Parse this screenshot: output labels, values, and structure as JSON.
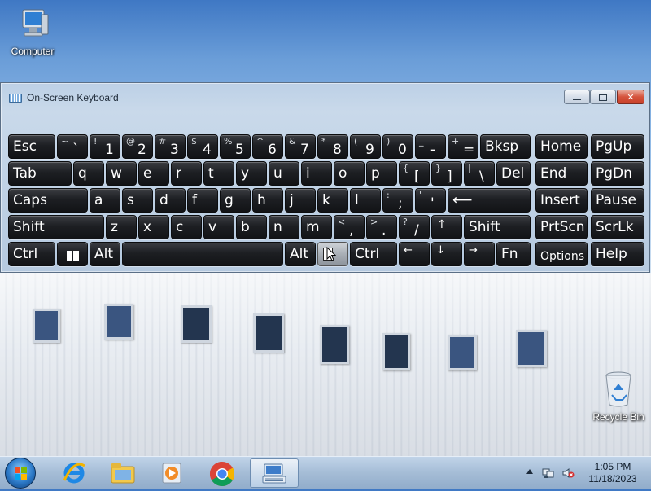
{
  "desktop": {
    "icons": [
      {
        "label": "Computer",
        "icon": "computer-icon"
      },
      {
        "label": "Recycle Bin",
        "icon": "recycle-bin-icon"
      }
    ]
  },
  "osk": {
    "title": "On-Screen Keyboard",
    "window_controls": [
      "minimize",
      "maximize",
      "close"
    ],
    "rows": [
      [
        {
          "label": "Esc"
        },
        {
          "shift": "~",
          "base": "`"
        },
        {
          "shift": "!",
          "base": "1"
        },
        {
          "shift": "@",
          "base": "2"
        },
        {
          "shift": "#",
          "base": "3"
        },
        {
          "shift": "$",
          "base": "4"
        },
        {
          "shift": "%",
          "base": "5"
        },
        {
          "shift": "^",
          "base": "6"
        },
        {
          "shift": "&",
          "base": "7"
        },
        {
          "shift": "*",
          "base": "8"
        },
        {
          "shift": "(",
          "base": "9"
        },
        {
          "shift": ")",
          "base": "0"
        },
        {
          "shift": "_",
          "base": "-"
        },
        {
          "shift": "+",
          "base": "="
        },
        {
          "label": "Bksp"
        },
        {
          "label": "Home"
        },
        {
          "label": "PgUp"
        }
      ],
      [
        {
          "label": "Tab"
        },
        {
          "label": "q"
        },
        {
          "label": "w"
        },
        {
          "label": "e"
        },
        {
          "label": "r"
        },
        {
          "label": "t"
        },
        {
          "label": "y"
        },
        {
          "label": "u"
        },
        {
          "label": "i"
        },
        {
          "label": "o"
        },
        {
          "label": "p"
        },
        {
          "shift": "{",
          "base": "["
        },
        {
          "shift": "}",
          "base": "]"
        },
        {
          "shift": "|",
          "base": "\\"
        },
        {
          "label": "Del"
        },
        {
          "label": "End"
        },
        {
          "label": "PgDn"
        }
      ],
      [
        {
          "label": "Caps"
        },
        {
          "label": "a"
        },
        {
          "label": "s"
        },
        {
          "label": "d"
        },
        {
          "label": "f"
        },
        {
          "label": "g"
        },
        {
          "label": "h"
        },
        {
          "label": "j"
        },
        {
          "label": "k"
        },
        {
          "label": "l"
        },
        {
          "shift": ":",
          "base": ";"
        },
        {
          "shift": "\"",
          "base": "'"
        },
        {
          "label": "⟵",
          "icon": "enter-arrow-icon"
        },
        {
          "label": "Insert"
        },
        {
          "label": "Pause"
        }
      ],
      [
        {
          "label": "Shift"
        },
        {
          "label": "z"
        },
        {
          "label": "x"
        },
        {
          "label": "c"
        },
        {
          "label": "v"
        },
        {
          "label": "b"
        },
        {
          "label": "n"
        },
        {
          "label": "m"
        },
        {
          "shift": "<",
          "base": ","
        },
        {
          "shift": ">",
          "base": "."
        },
        {
          "shift": "?",
          "base": "/"
        },
        {
          "label": "↑",
          "icon": "up-arrow-icon"
        },
        {
          "label": "Shift"
        },
        {
          "label": "PrtScn"
        },
        {
          "label": "ScrLk"
        }
      ],
      [
        {
          "label": "Ctrl"
        },
        {
          "label": "",
          "icon": "windows-logo-icon"
        },
        {
          "label": "Alt"
        },
        {
          "label": "",
          "icon": "space-bar"
        },
        {
          "label": "Alt"
        },
        {
          "label": "",
          "icon": "context-menu-icon"
        },
        {
          "label": "Ctrl"
        },
        {
          "label": "←",
          "icon": "left-arrow-icon"
        },
        {
          "label": "↓",
          "icon": "down-arrow-icon"
        },
        {
          "label": "→",
          "icon": "right-arrow-icon"
        },
        {
          "label": "Fn"
        },
        {
          "label": "Options"
        },
        {
          "label": "Help"
        }
      ]
    ]
  },
  "taskbar": {
    "apps": [
      {
        "icon": "internet-explorer-icon"
      },
      {
        "icon": "windows-explorer-icon"
      },
      {
        "icon": "media-player-icon"
      },
      {
        "icon": "chrome-icon"
      },
      {
        "icon": "on-screen-keyboard-icon",
        "active": true
      }
    ],
    "tray_icons": [
      "show-hidden-icons-icon",
      "network-icon",
      "volume-muted-icon"
    ],
    "clock": {
      "time": "1:05 PM",
      "date": "11/18/2023"
    }
  },
  "colors": {
    "key_bg": "#1d1f23",
    "key_text": "#ffffff",
    "close_button": "#c8402a",
    "window_frame": "#bcd0e6"
  }
}
